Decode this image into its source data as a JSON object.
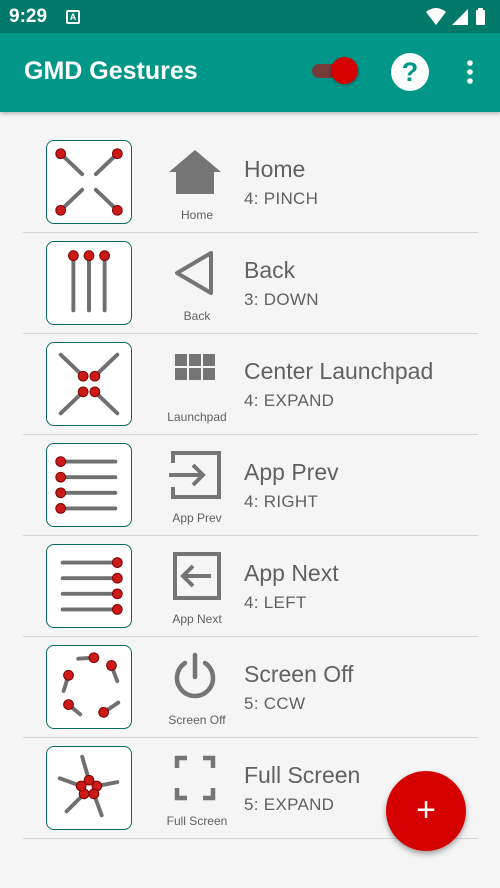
{
  "status": {
    "time": "9:29",
    "notif_letter": "A"
  },
  "app": {
    "title": "GMD Gestures",
    "help_label": "?",
    "enabled": true
  },
  "colors": {
    "primary": "#009688",
    "primary_dark": "#00796b",
    "accent": "#d50000",
    "icon_gray": "#757575"
  },
  "gestures": [
    {
      "name": "Home",
      "spec": "4: PINCH",
      "caption": "Home",
      "gesture_icon": "pinch-4-icon",
      "action_icon": "home-icon"
    },
    {
      "name": "Back",
      "spec": "3: DOWN",
      "caption": "Back",
      "gesture_icon": "down-3-icon",
      "action_icon": "back-triangle-icon"
    },
    {
      "name": "Center Launchpad",
      "spec": "4: EXPAND",
      "caption": "Launchpad",
      "gesture_icon": "expand-4-icon",
      "action_icon": "grid-icon"
    },
    {
      "name": "App Prev",
      "spec": "4: RIGHT",
      "caption": "App Prev",
      "gesture_icon": "right-4-icon",
      "action_icon": "enter-right-icon"
    },
    {
      "name": "App Next",
      "spec": "4: LEFT",
      "caption": "App Next",
      "gesture_icon": "left-4-icon",
      "action_icon": "enter-left-icon"
    },
    {
      "name": "Screen Off",
      "spec": "5: CCW",
      "caption": "Screen Off",
      "gesture_icon": "ccw-5-icon",
      "action_icon": "power-icon"
    },
    {
      "name": "Full Screen",
      "spec": "5: EXPAND",
      "caption": "Full Screen",
      "gesture_icon": "expand-5-icon",
      "action_icon": "fullscreen-icon"
    }
  ],
  "fab": {
    "label": "+"
  }
}
